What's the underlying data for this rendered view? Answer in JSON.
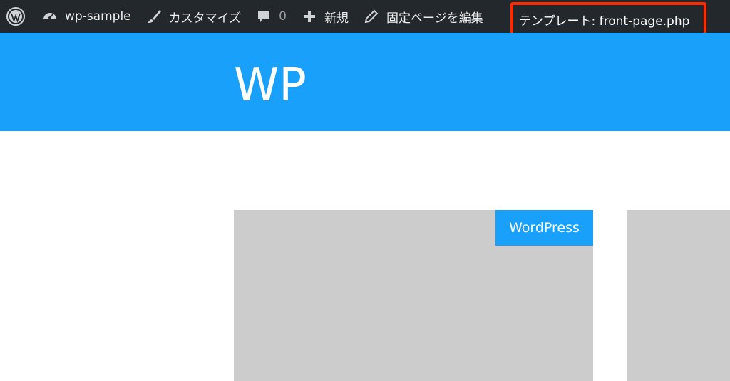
{
  "adminbar": {
    "site_name": "wp-sample",
    "customize": "カスタマイズ",
    "comments_count": "0",
    "new": "新規",
    "edit_page": "固定ページを編集",
    "template": "テンプレート: front-page.php"
  },
  "header": {
    "site_title": "WP"
  },
  "cards": [
    {
      "category": "WordPress"
    }
  ],
  "colors": {
    "adminbar_bg": "#23282d",
    "accent": "#18a0fb",
    "highlight_border": "#ff2a00",
    "card_bg": "#cccccc"
  }
}
